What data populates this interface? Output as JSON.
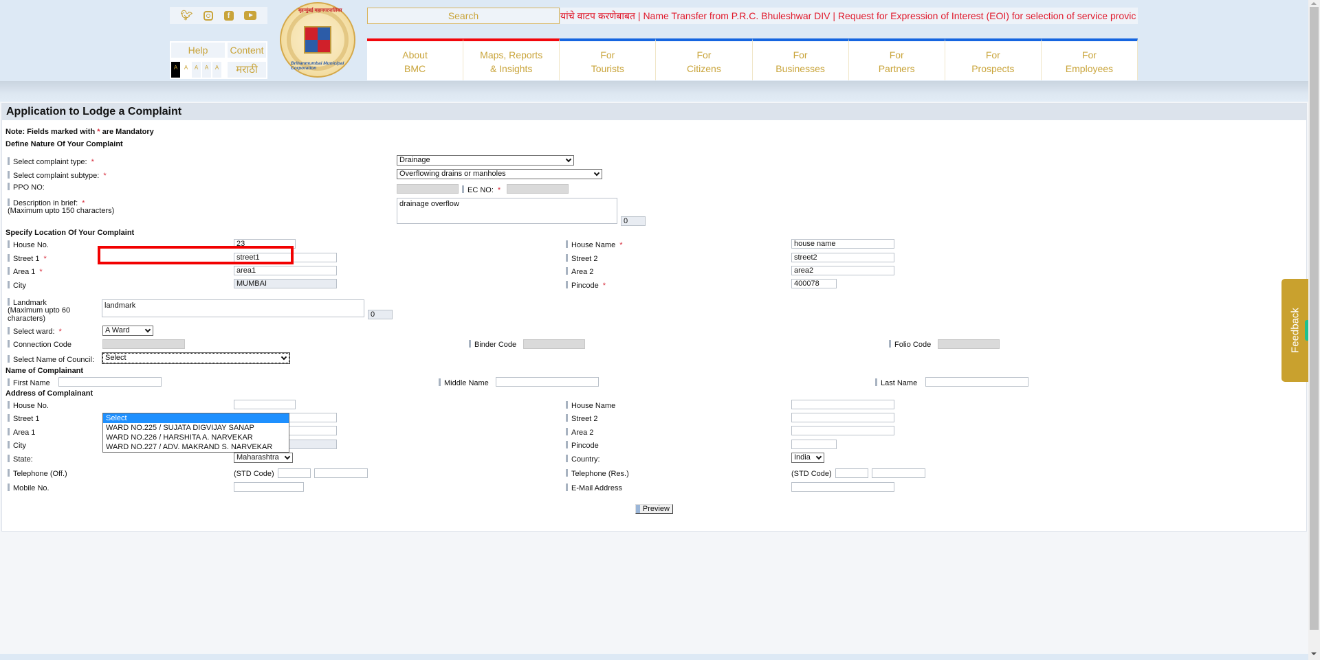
{
  "header": {
    "social": [
      "twitter-icon",
      "instagram-icon",
      "facebook-icon",
      "youtube-icon"
    ],
    "help_label": "Help",
    "content_label": "Content",
    "language_label": "मराठी",
    "font_size_buttons": [
      "A",
      "A",
      "A",
      "A",
      "A"
    ],
    "logo_text_top": "बृहन्मुंबई महानगरपालिका",
    "logo_text_bottom": "Brihanmumbai Municipal Corporation",
    "search_placeholder": "Search",
    "ticker": "यांचे वाटप करणेबाबत | Name Transfer from P.R.C. Bhuleshwar DIV | Request for Expression of Interest (EOI) for selection of service provic",
    "nav": [
      {
        "line1": "About",
        "line2": "BMC"
      },
      {
        "line1": "Maps, Reports",
        "line2": "& Insights"
      },
      {
        "line1": "For",
        "line2": "Tourists"
      },
      {
        "line1": "For",
        "line2": "Citizens"
      },
      {
        "line1": "For",
        "line2": "Businesses"
      },
      {
        "line1": "For",
        "line2": "Partners"
      },
      {
        "line1": "For",
        "line2": "Prospects"
      },
      {
        "line1": "For",
        "line2": "Employees"
      }
    ],
    "colors": {
      "gold": "#c9a43a",
      "red": "#f2070c",
      "blue": "#1565e0",
      "ticker_red": "#e0192b"
    }
  },
  "form": {
    "title": "Application to Lodge a Complaint",
    "note_prefix": "Note: Fields marked with ",
    "note_star": "*",
    "note_suffix": " are Mandatory",
    "section_nature": "Define Nature Of Your Complaint",
    "complaint_type_label": "Select complaint type:",
    "complaint_type_value": "Drainage",
    "complaint_subtype_label": "Select complaint subtype:",
    "complaint_subtype_value": "Overflowing drains or manholes",
    "ppo_label": "PPO NO:",
    "ppo_value": "",
    "ec_label": "EC NO:",
    "ec_value": "",
    "desc_label": "Description in brief:",
    "desc_hint": "(Maximum upto 150 characters)",
    "desc_value": "drainage overflow",
    "desc_count": "0",
    "section_location": "Specify Location Of Your Complaint",
    "loc": {
      "house_no_label": "House No.",
      "house_no_value": "23",
      "street1_label": "Street 1",
      "street1_value": "street1",
      "area1_label": "Area 1",
      "area1_value": "area1",
      "city_label": "City",
      "city_value": "MUMBAI",
      "house_name_label": "House Name",
      "house_name_value": "house name",
      "street2_label": "Street 2",
      "street2_value": "street2",
      "area2_label": "Area 2",
      "area2_value": "area2",
      "pincode_label": "Pincode",
      "pincode_value": "400078",
      "landmark_label": "Landmark",
      "landmark_hint": "(Maximum upto 60 characters)",
      "landmark_value": "landmark",
      "landmark_count": "0",
      "ward_label": "Select ward:",
      "ward_value": "A Ward",
      "connection_label": "Connection Code",
      "binder_label": "Binder Code",
      "folio_label": "Folio Code",
      "council_label": "Select Name of Council:",
      "council_value": "Select",
      "council_options": [
        "Select",
        "WARD NO.225 / SUJATA DIGVIJAY SANAP",
        "WARD NO.226 / HARSHITA A. NARVEKAR",
        "WARD NO.227 / ADV. MAKRAND S. NARVEKAR"
      ]
    },
    "section_name": "Name of Complainant",
    "first_name_label": "First Name",
    "middle_name_label": "Middle Name",
    "last_name_label": "Last Name",
    "section_address": "Address of Complainant",
    "addr": {
      "house_no_label": "House No.",
      "street1_label": "Street 1",
      "area1_label": "Area 1",
      "city_label": "City",
      "state_label": "State:",
      "state_value": "Maharashtra",
      "tel_off_label": "Telephone (Off.)",
      "std_label": "(STD Code)",
      "mobile_label": "Mobile No.",
      "house_name_label": "House Name",
      "street2_label": "Street 2",
      "area2_label": "Area 2",
      "pincode_label": "Pincode",
      "country_label": "Country:",
      "country_value": "India",
      "tel_res_label": "Telephone (Res.)",
      "email_label": "E-Mail Address"
    },
    "preview_label": "Preview",
    "required_color": "#d62a3a"
  },
  "feedback_label": "Feedback"
}
